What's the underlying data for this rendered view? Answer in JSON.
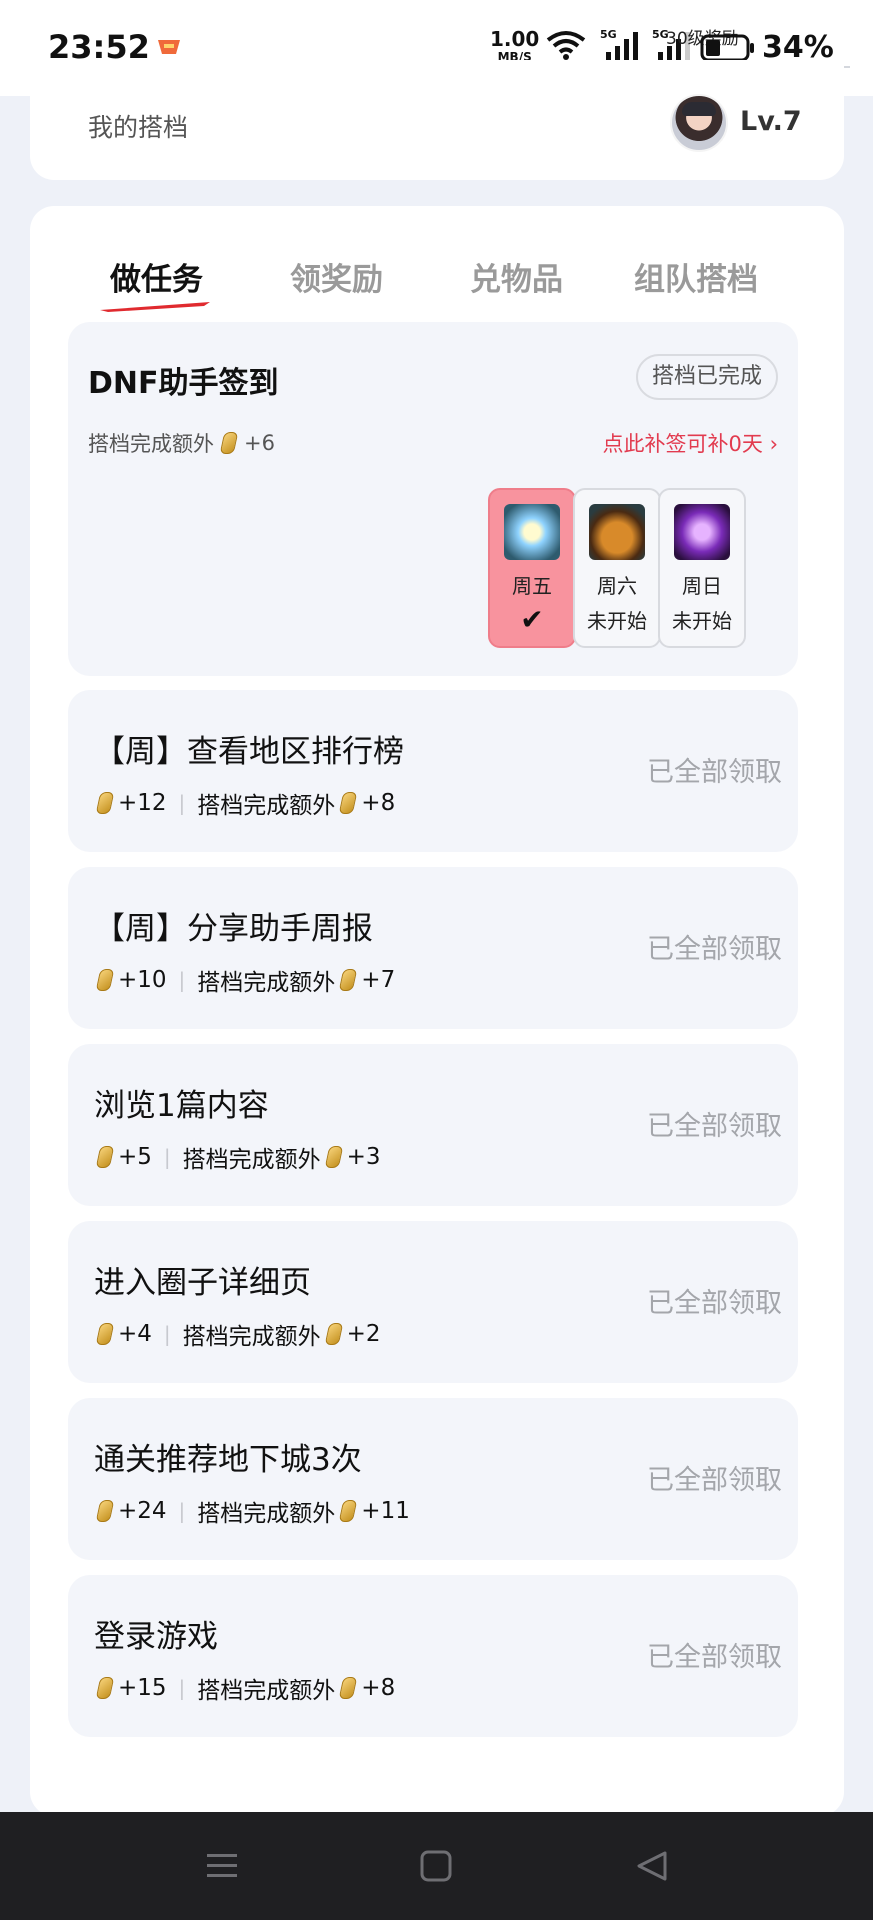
{
  "status_bar": {
    "time": "23:52",
    "net_speed": "1.00",
    "net_unit": "MB/S",
    "net1": "5G",
    "net2": "5G",
    "overlay_text": "30级奖励",
    "battery": "34%"
  },
  "header": {
    "label": "我的搭档",
    "level": "Lv.7"
  },
  "tabs": [
    {
      "label": "做任务",
      "active": true
    },
    {
      "label": "领奖励",
      "active": false
    },
    {
      "label": "兑物品",
      "active": false
    },
    {
      "label": "组队搭档",
      "active": false
    }
  ],
  "sign_in": {
    "title": "DNF助手签到",
    "badge": "搭档已完成",
    "extra_label": "搭档完成额外",
    "extra_value": "+6",
    "makeup_link": "点此补签可补0天",
    "days": [
      {
        "name": "周五",
        "status": "",
        "done": true
      },
      {
        "name": "周六",
        "status": "未开始",
        "done": false
      },
      {
        "name": "周日",
        "status": "未开始",
        "done": false
      }
    ]
  },
  "tasks": [
    {
      "title": "【周】查看地区排行榜",
      "reward": "+12",
      "extra_label": "搭档完成额外",
      "extra": "+8",
      "action": "已全部领取"
    },
    {
      "title": "【周】分享助手周报",
      "reward": "+10",
      "extra_label": "搭档完成额外",
      "extra": "+7",
      "action": "已全部领取"
    },
    {
      "title": "浏览1篇内容",
      "reward": "+5",
      "extra_label": "搭档完成额外",
      "extra": "+3",
      "action": "已全部领取"
    },
    {
      "title": "进入圈子详细页",
      "reward": "+4",
      "extra_label": "搭档完成额外",
      "extra": "+2",
      "action": "已全部领取"
    },
    {
      "title": "通关推荐地下城3次",
      "reward": "+24",
      "extra_label": "搭档完成额外",
      "extra": "+11",
      "action": "已全部领取"
    },
    {
      "title": "登录游戏",
      "reward": "+15",
      "extra_label": "搭档完成额外",
      "extra": "+8",
      "action": "已全部领取"
    }
  ],
  "nav": {
    "menu_icon": "menu-icon",
    "home_icon": "home-icon",
    "back_icon": "back-icon"
  },
  "colors": {
    "accent_red": "#e23b4f",
    "done_day": "#f8939e"
  }
}
